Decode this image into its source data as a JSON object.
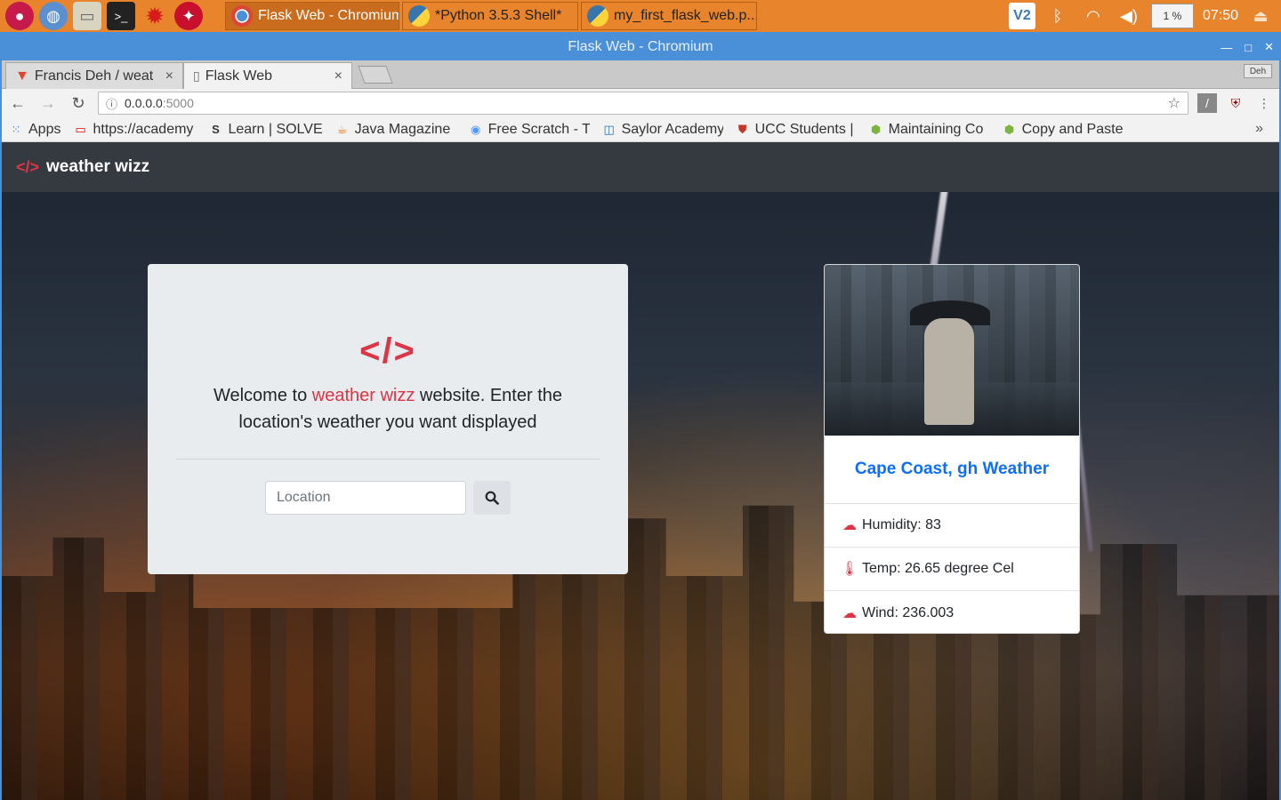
{
  "taskbar": {
    "launchers": [
      "raspberry-icon",
      "globe-icon",
      "folder-icon",
      "terminal-icon",
      "burst-icon",
      "mathematica-icon"
    ],
    "tasks": [
      {
        "label": "Flask Web - Chromium",
        "active": true
      },
      {
        "label": "*Python 3.5.3 Shell*",
        "active": false
      },
      {
        "label": "my_first_flask_web.p...",
        "active": false
      }
    ],
    "tray": {
      "vnc": "V2",
      "cpu": "1 %",
      "clock": "07:50"
    }
  },
  "window": {
    "title": "Flask Web - Chromium"
  },
  "browser": {
    "tabs": [
      {
        "label": "Francis Deh / weat",
        "active": false
      },
      {
        "label": "Flask Web",
        "active": true
      }
    ],
    "profile_label": "Deh",
    "url_host": "0.0.0.0",
    "url_port": ":5000",
    "bookmarks": [
      {
        "label": "Apps",
        "icon": "apps-grid-icon"
      },
      {
        "label": "https://academy",
        "icon": "oracle-icon"
      },
      {
        "label": "Learn | SOLVE",
        "icon": "solve-icon"
      },
      {
        "label": "Java Magazine",
        "icon": "java-icon"
      },
      {
        "label": "Free Scratch - T",
        "icon": "scratch-icon"
      },
      {
        "label": "Saylor Academy",
        "icon": "saylor-icon"
      },
      {
        "label": "UCC Students |",
        "icon": "ucc-icon"
      },
      {
        "label": "Maintaining Co",
        "icon": "android-icon"
      },
      {
        "label": "Copy and Paste",
        "icon": "android-icon"
      }
    ]
  },
  "site": {
    "brand": "weather wizz",
    "welcome_prefix": "Welcome to ",
    "welcome_highlight": "weather wizz",
    "welcome_suffix": " website. Enter the location's weather you want displayed",
    "search_placeholder": "Location"
  },
  "weather_card": {
    "title": "Cape Coast, gh Weather",
    "humidity": "Humidity: 83",
    "temp": "Temp: 26.65 degree Cel",
    "wind": "Wind: 236.003"
  },
  "colors": {
    "accent": "#dc3545",
    "link": "#0d6efd",
    "navbar": "#343a40",
    "taskbar": "#e8842c",
    "titlebar": "#4a90d9"
  }
}
